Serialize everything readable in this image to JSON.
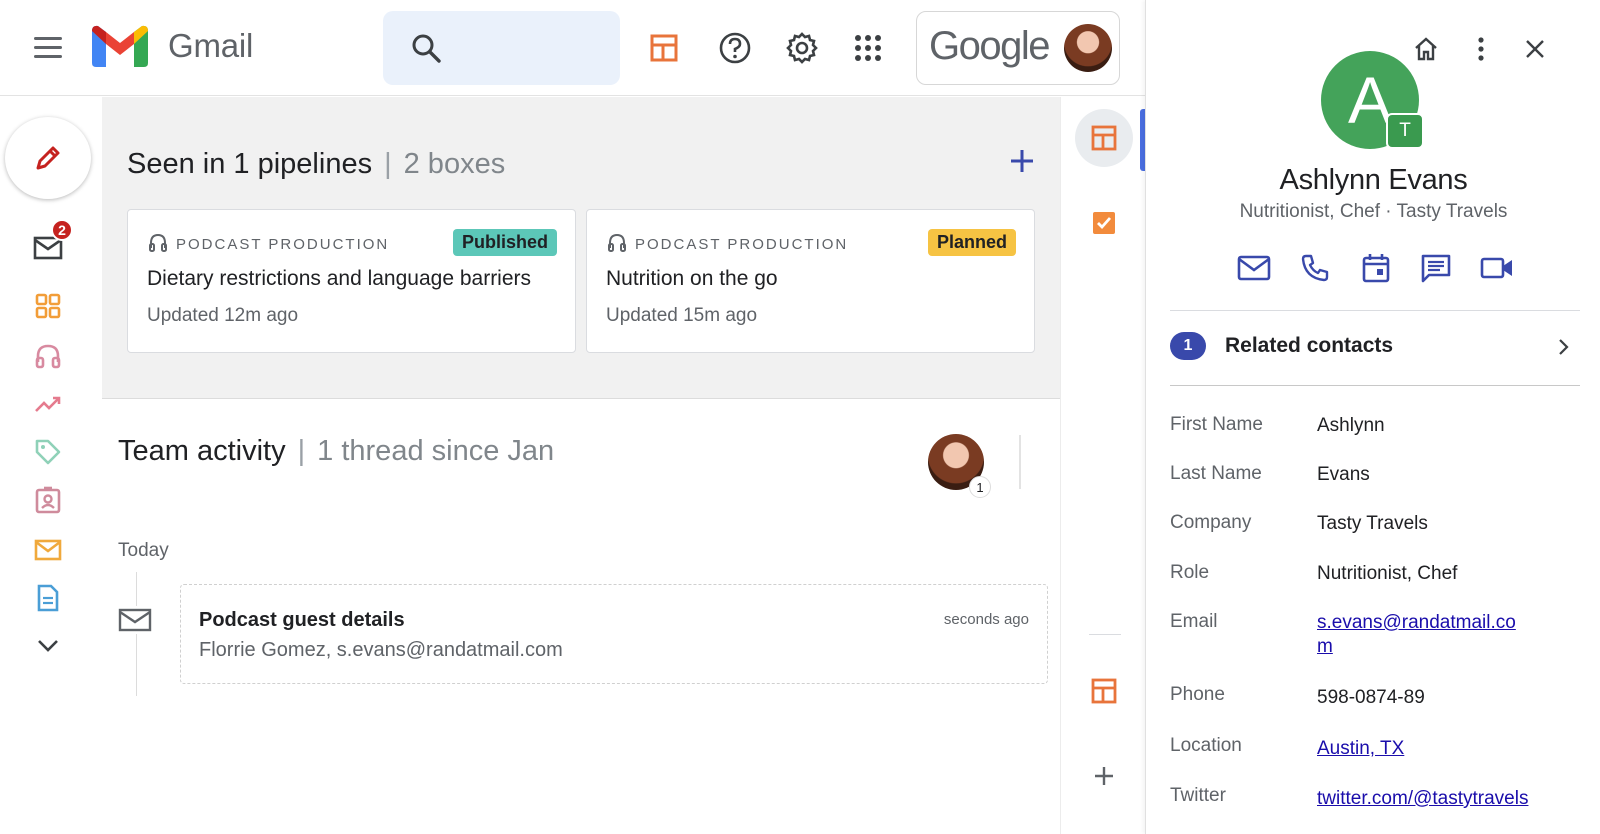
{
  "app": {
    "name": "Gmail",
    "account_brand": "Google"
  },
  "pipelines": {
    "title": "Seen in 1 pipelines",
    "subtitle": "2 boxes",
    "cards": [
      {
        "pipeline": "PODCAST PRODUCTION",
        "stage": "Published",
        "stage_color": "#5cc7b8",
        "title": "Dietary restrictions and language barriers",
        "updated": "Updated 12m ago"
      },
      {
        "pipeline": "PODCAST PRODUCTION",
        "stage": "Planned",
        "stage_color": "#f6c343",
        "title": "Nutrition on the go",
        "updated": "Updated 15m ago"
      }
    ]
  },
  "team": {
    "title": "Team activity",
    "subtitle": "1 thread since Jan",
    "avatar_count": "1",
    "group_label": "Today",
    "thread": {
      "subject": "Podcast guest details",
      "participants": "Florrie Gomez, s.evans@randatmail.com",
      "time": "seconds ago"
    }
  },
  "rail": {
    "inbox_badge": "2"
  },
  "contact": {
    "initial": "A",
    "badge_initial": "T",
    "name": "Ashlynn Evans",
    "subtitle": "Nutritionist, Chef · Tasty Travels",
    "related_count": "1",
    "related_label": "Related contacts",
    "fields": [
      {
        "label": "First Name",
        "value": "Ashlynn"
      },
      {
        "label": "Last Name",
        "value": "Evans"
      },
      {
        "label": "Company",
        "value": "Tasty Travels"
      },
      {
        "label": "Role",
        "value": "Nutritionist, Chef"
      },
      {
        "label": "Email",
        "value": "s.evans@randatmail.com"
      },
      {
        "label": "Phone",
        "value": "598-0874-89"
      },
      {
        "label": "Location",
        "value": "Austin, TX"
      },
      {
        "label": "Twitter",
        "value": "twitter.com/@tastytravels"
      }
    ]
  },
  "colors": {
    "accent_orange": "#e8743b",
    "accent_blue": "#3949ab",
    "avatar_green": "#44a35a"
  }
}
